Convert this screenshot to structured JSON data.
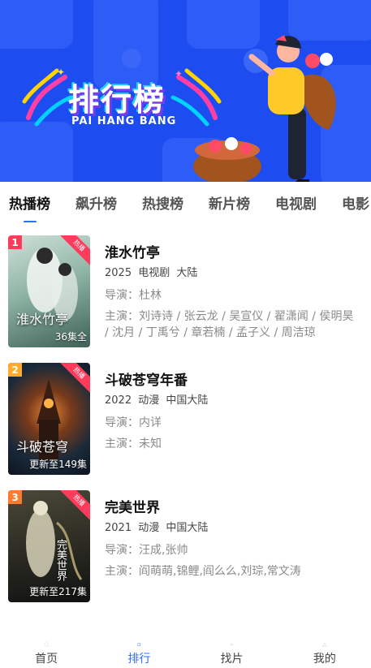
{
  "banner": {
    "title": "排行榜",
    "subtitle": "PAI HANG BANG",
    "background": "#1d4cf0"
  },
  "tabs": [
    {
      "label": "热播榜",
      "active": true
    },
    {
      "label": "飙升榜",
      "active": false
    },
    {
      "label": "热搜榜",
      "active": false
    },
    {
      "label": "新片榜",
      "active": false
    },
    {
      "label": "电视剧",
      "active": false
    },
    {
      "label": "电影",
      "active": false
    }
  ],
  "items": [
    {
      "rank": "1",
      "rank_color": "#ff3b5c",
      "hot_badge": "热播",
      "poster_note": "36集全",
      "poster_art": "淮水竹亭",
      "poster_colors": [
        "#8fb5a6",
        "#cfe0d8",
        "#2f4a42"
      ],
      "title": "淮水竹亭",
      "year": "2025",
      "type": "电视剧",
      "region": "大陆",
      "director_label": "导演：",
      "director": "杜林",
      "cast_label": "主演：",
      "cast": "刘诗诗 / 张云龙 / 吴宣仪 / 翟潇闻 / 侯明昊 / 沈月 / 丁禹兮 / 章若楠 / 孟子义 / 周洁琼"
    },
    {
      "rank": "2",
      "rank_color": "#ffaa2b",
      "hot_badge": "热播",
      "poster_note": "更新至149集",
      "poster_art": "斗破苍穹",
      "poster_colors": [
        "#1a2a3a",
        "#c06a2a",
        "#0d1520"
      ],
      "title": "斗破苍穹年番",
      "year": "2022",
      "type": "动漫",
      "region": "中国大陆",
      "director_label": "导演：",
      "director": "内详",
      "cast_label": "主演：",
      "cast": "未知"
    },
    {
      "rank": "3",
      "rank_color": "#ff7a2b",
      "hot_badge": "热播",
      "poster_note": "更新至217集",
      "poster_art": "完美世界",
      "poster_colors": [
        "#2a2a22",
        "#8c8a70",
        "#111"
      ],
      "title": "完美世界",
      "year": "2021",
      "type": "动漫",
      "region": "中国大陆",
      "director_label": "导演：",
      "director": "汪成,张帅",
      "cast_label": "主演：",
      "cast": "阎萌萌,锦鲤,阎么么,刘琮,常文涛"
    }
  ],
  "bottom_nav": [
    {
      "label": "首页",
      "icon": "home-icon",
      "active": false
    },
    {
      "label": "排行",
      "icon": "ranking-icon",
      "active": true
    },
    {
      "label": "找片",
      "icon": "search-icon",
      "active": false
    },
    {
      "label": "我的",
      "icon": "profile-icon",
      "active": false
    }
  ],
  "colors": {
    "accent": "#2f6bff",
    "hot_badge": "#ff3b5c"
  }
}
